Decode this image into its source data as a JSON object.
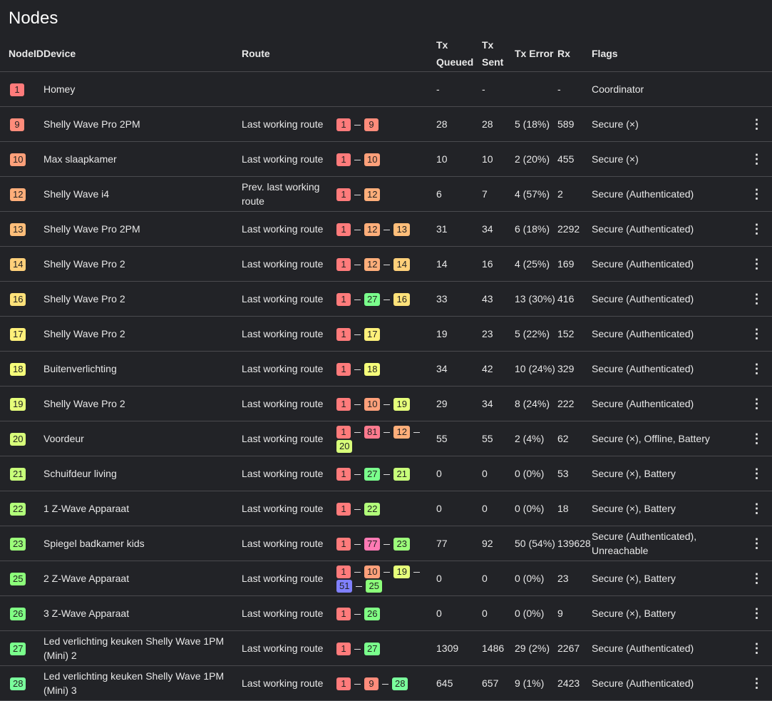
{
  "title": "Nodes",
  "headers": {
    "nodeid": "NodeID",
    "device": "Device",
    "route": "Route",
    "txq": "Tx Queued",
    "txs": "Tx Sent",
    "txe": "Tx Error",
    "rx": "Rx",
    "flags": "Flags"
  },
  "menu_icon": "⋮",
  "colors": {
    "1": "#ff7b7b",
    "9": "#ff8c7b",
    "10": "#ffa07a",
    "12": "#ffae7a",
    "13": "#ffbe7a",
    "14": "#ffd07a",
    "16": "#ffe27a",
    "17": "#fff07a",
    "18": "#f6ff7a",
    "19": "#e6ff7a",
    "20": "#d8ff7a",
    "21": "#c8ff7a",
    "22": "#b2ff7a",
    "23": "#9cff7a",
    "25": "#8cff7a",
    "26": "#80ff84",
    "27": "#7aff8c",
    "28": "#7aff9c",
    "51": "#8080ff",
    "77": "#ff7ab4",
    "81": "#ff7a8e"
  },
  "rows": [
    {
      "id": "1",
      "device": "Homey",
      "route": "",
      "hops": [],
      "txq": "-",
      "txs": "-",
      "txe": "",
      "rx": "-",
      "flags": "Coordinator",
      "menu": false
    },
    {
      "id": "9",
      "device": "Shelly Wave Pro 2PM",
      "route": "Last working route",
      "hops": [
        "1",
        "9"
      ],
      "txq": "28",
      "txs": "28",
      "txe": "5 (18%)",
      "rx": "589",
      "flags": "Secure (×)",
      "menu": true
    },
    {
      "id": "10",
      "device": "Max slaapkamer",
      "route": "Last working route",
      "hops": [
        "1",
        "10"
      ],
      "txq": "10",
      "txs": "10",
      "txe": "2 (20%)",
      "rx": "455",
      "flags": "Secure (×)",
      "menu": true
    },
    {
      "id": "12",
      "device": "Shelly Wave i4",
      "route": "Prev. last working route",
      "hops": [
        "1",
        "12"
      ],
      "txq": "6",
      "txs": "7",
      "txe": "4 (57%)",
      "rx": "2",
      "flags": "Secure (Authenticated)",
      "menu": true
    },
    {
      "id": "13",
      "device": "Shelly Wave Pro 2PM",
      "route": "Last working route",
      "hops": [
        "1",
        "12",
        "13"
      ],
      "txq": "31",
      "txs": "34",
      "txe": "6 (18%)",
      "rx": "2292",
      "flags": "Secure (Authenticated)",
      "menu": true
    },
    {
      "id": "14",
      "device": "Shelly Wave Pro 2",
      "route": "Last working route",
      "hops": [
        "1",
        "12",
        "14"
      ],
      "txq": "14",
      "txs": "16",
      "txe": "4 (25%)",
      "rx": "169",
      "flags": "Secure (Authenticated)",
      "menu": true
    },
    {
      "id": "16",
      "device": "Shelly Wave Pro 2",
      "route": "Last working route",
      "hops": [
        "1",
        "27",
        "16"
      ],
      "txq": "33",
      "txs": "43",
      "txe": "13 (30%)",
      "rx": "416",
      "flags": "Secure (Authenticated)",
      "menu": true
    },
    {
      "id": "17",
      "device": "Shelly Wave Pro 2",
      "route": "Last working route",
      "hops": [
        "1",
        "17"
      ],
      "txq": "19",
      "txs": "23",
      "txe": "5 (22%)",
      "rx": "152",
      "flags": "Secure (Authenticated)",
      "menu": true
    },
    {
      "id": "18",
      "device": "Buitenverlichting",
      "route": "Last working route",
      "hops": [
        "1",
        "18"
      ],
      "txq": "34",
      "txs": "42",
      "txe": "10 (24%)",
      "rx": "329",
      "flags": "Secure (Authenticated)",
      "menu": true
    },
    {
      "id": "19",
      "device": "Shelly Wave Pro 2",
      "route": "Last working route",
      "hops": [
        "1",
        "10",
        "19"
      ],
      "txq": "29",
      "txs": "34",
      "txe": "8 (24%)",
      "rx": "222",
      "flags": "Secure (Authenticated)",
      "menu": true
    },
    {
      "id": "20",
      "device": "Voordeur",
      "route": "Last working route",
      "hops": [
        "1",
        "81",
        "12",
        "20"
      ],
      "txq": "55",
      "txs": "55",
      "txe": "2 (4%)",
      "rx": "62",
      "flags": "Secure (×), Offline, Battery",
      "menu": true
    },
    {
      "id": "21",
      "device": "Schuifdeur living",
      "route": "Last working route",
      "hops": [
        "1",
        "27",
        "21"
      ],
      "txq": "0",
      "txs": "0",
      "txe": "0 (0%)",
      "rx": "53",
      "flags": "Secure (×), Battery",
      "menu": true
    },
    {
      "id": "22",
      "device": "1 Z-Wave Apparaat",
      "route": "Last working route",
      "hops": [
        "1",
        "22"
      ],
      "txq": "0",
      "txs": "0",
      "txe": "0 (0%)",
      "rx": "18",
      "flags": "Secure (×), Battery",
      "menu": true
    },
    {
      "id": "23",
      "device": "Spiegel badkamer kids",
      "route": "Last working route",
      "hops": [
        "1",
        "77",
        "23"
      ],
      "txq": "77",
      "txs": "92",
      "txe": "50 (54%)",
      "rx": "139628",
      "flags": "Secure (Authenticated), Unreachable",
      "menu": true
    },
    {
      "id": "25",
      "device": "2 Z-Wave Apparaat",
      "route": "Last working route",
      "hops": [
        "1",
        "10",
        "19",
        "51",
        "25"
      ],
      "txq": "0",
      "txs": "0",
      "txe": "0 (0%)",
      "rx": "23",
      "flags": "Secure (×), Battery",
      "menu": true
    },
    {
      "id": "26",
      "device": "3 Z-Wave Apparaat",
      "route": "Last working route",
      "hops": [
        "1",
        "26"
      ],
      "txq": "0",
      "txs": "0",
      "txe": "0 (0%)",
      "rx": "9",
      "flags": "Secure (×), Battery",
      "menu": true
    },
    {
      "id": "27",
      "device": "Led verlichting keuken Shelly Wave 1PM (Mini) 2",
      "route": "Last working route",
      "hops": [
        "1",
        "27"
      ],
      "txq": "1309",
      "txs": "1486",
      "txe": "29 (2%)",
      "rx": "2267",
      "flags": "Secure (Authenticated)",
      "menu": true
    },
    {
      "id": "28",
      "device": "Led verlichting keuken Shelly Wave 1PM (Mini) 3",
      "route": "Last working route",
      "hops": [
        "1",
        "9",
        "28"
      ],
      "txq": "645",
      "txs": "657",
      "txe": "9 (1%)",
      "rx": "2423",
      "flags": "Secure (Authenticated)",
      "menu": true
    }
  ]
}
